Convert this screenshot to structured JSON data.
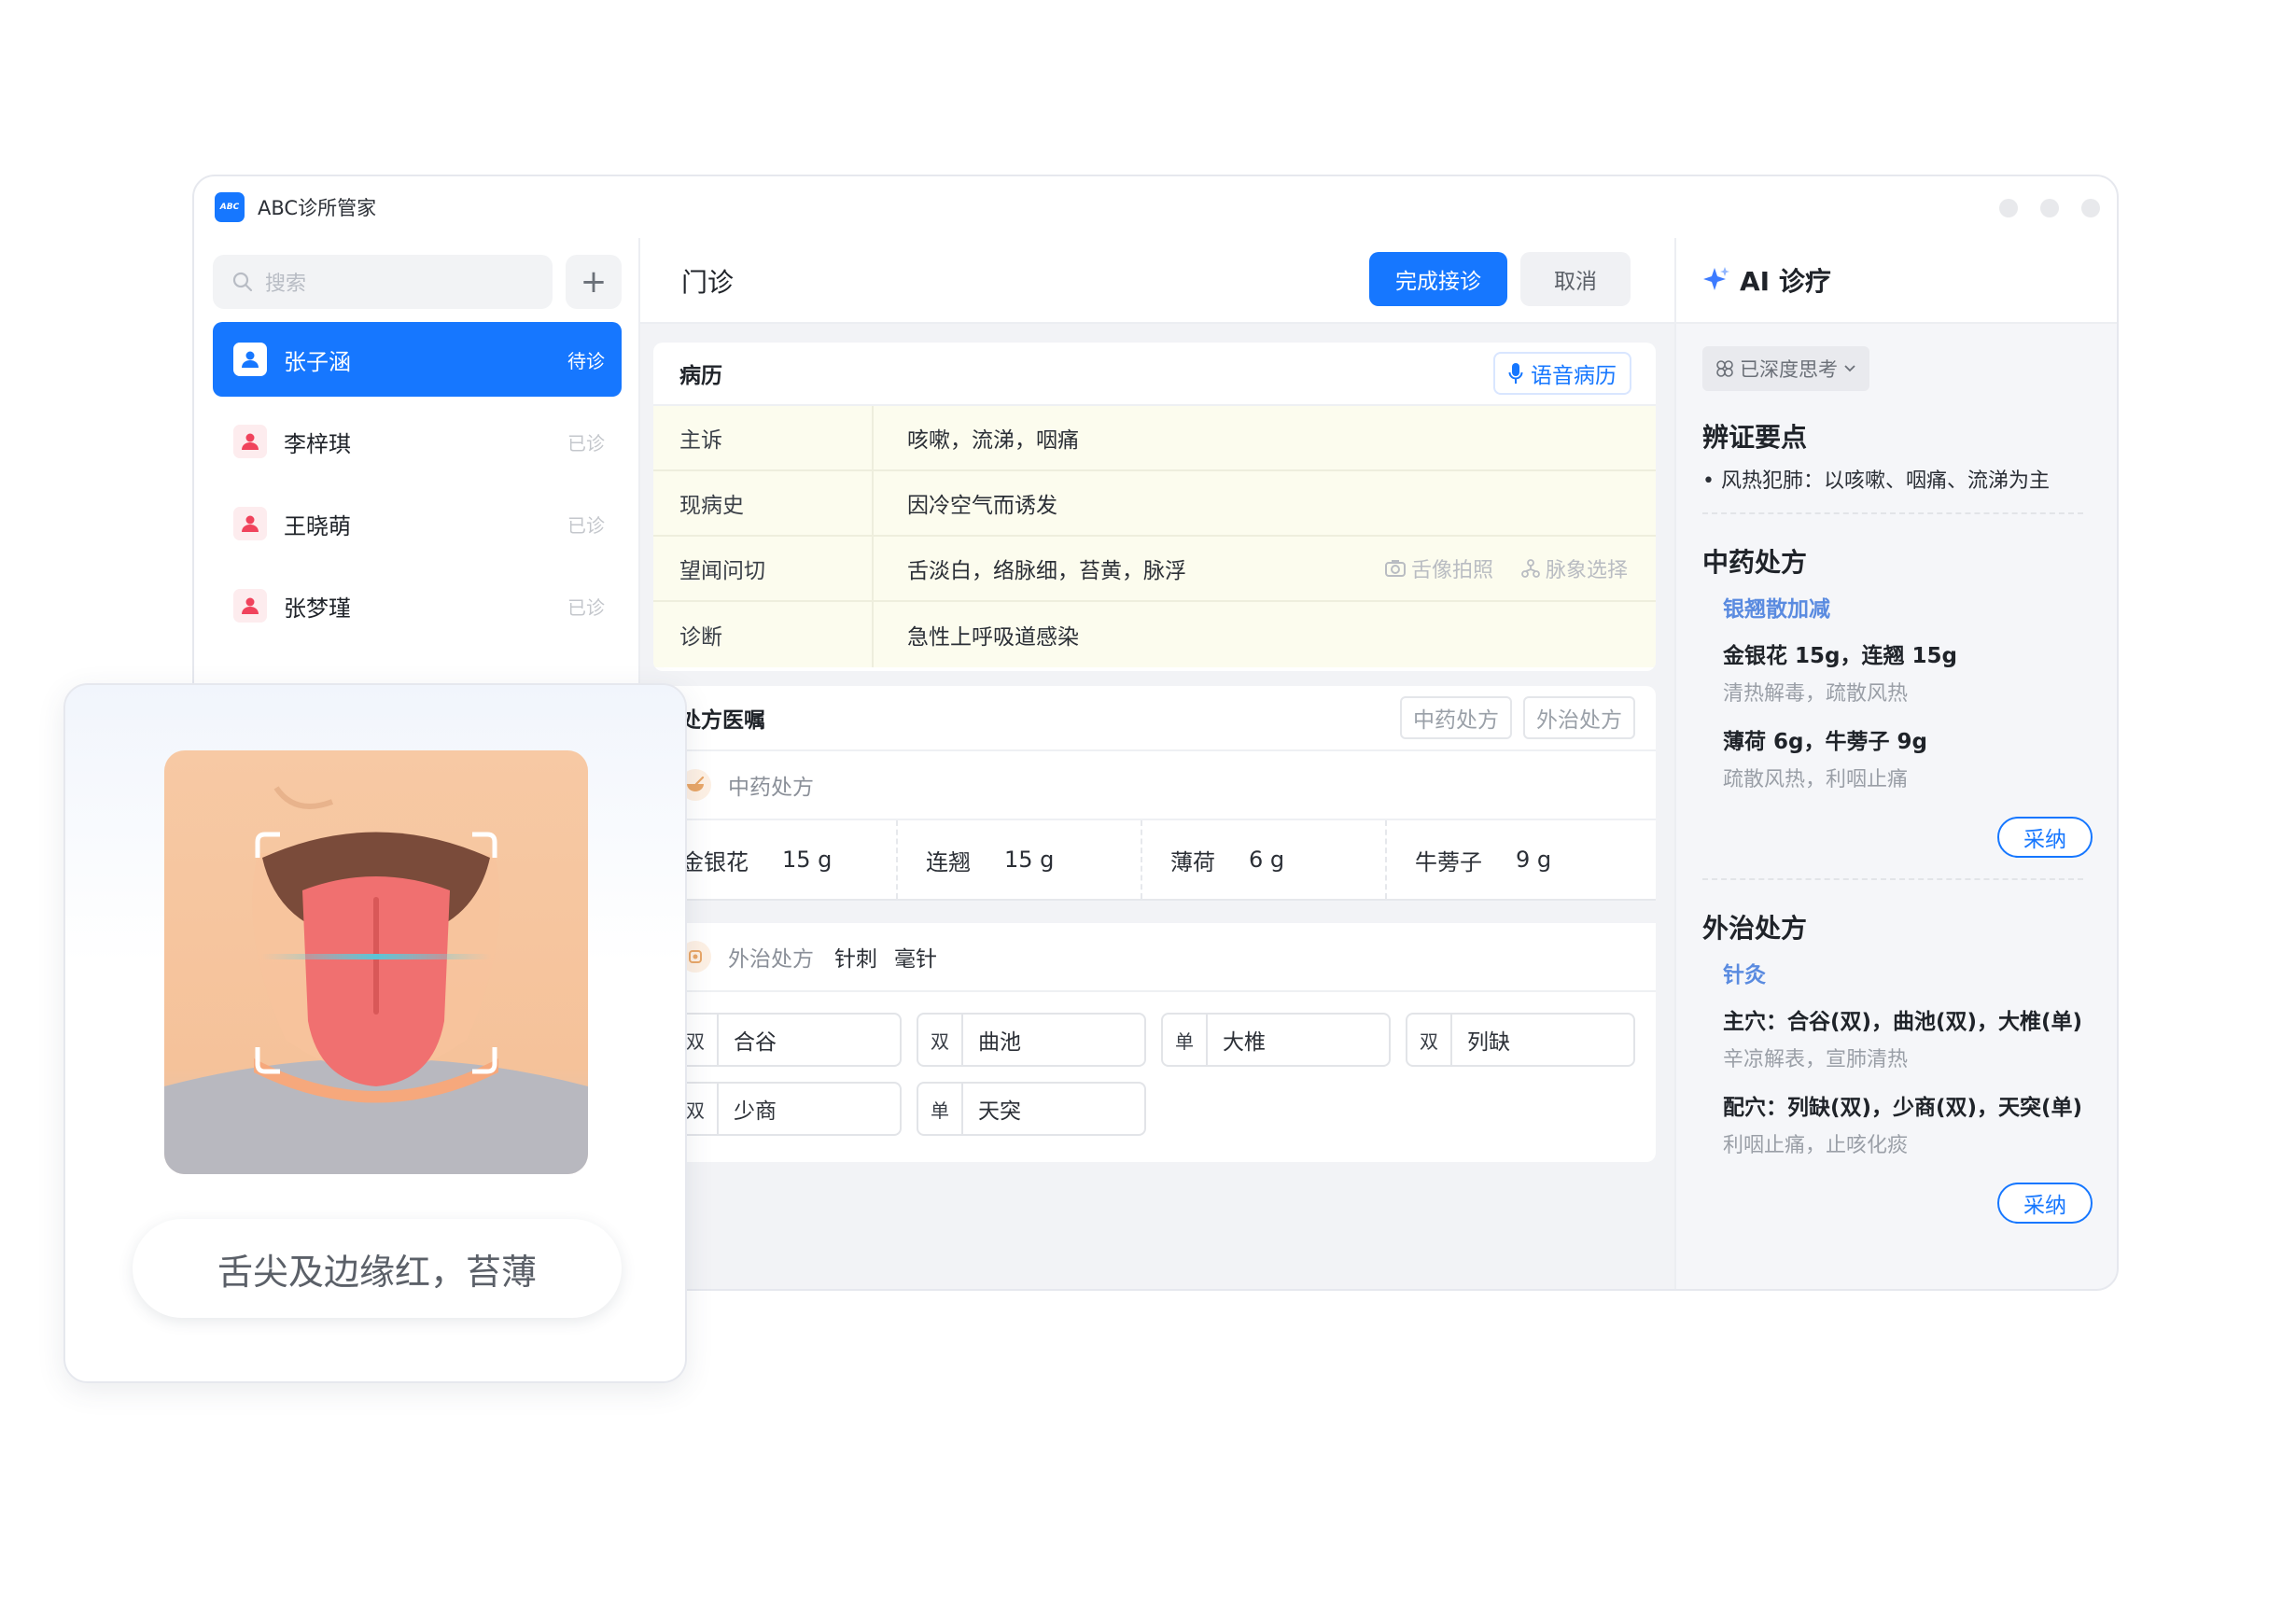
{
  "app": {
    "logo_text": "ABC",
    "title": "ABC诊所管家"
  },
  "sidebar": {
    "search_placeholder": "搜索",
    "add_label": "+",
    "patients": [
      {
        "name": "张子涵",
        "status": "待诊",
        "active": true
      },
      {
        "name": "李梓琪",
        "status": "已诊",
        "active": false
      },
      {
        "name": "王晓萌",
        "status": "已诊",
        "active": false
      },
      {
        "name": "张梦瑾",
        "status": "已诊",
        "active": false
      }
    ]
  },
  "main": {
    "title": "门诊",
    "complete_button": "完成接诊",
    "cancel_button": "取消",
    "record": {
      "title": "病历",
      "voice_button": "语音病历",
      "rows": [
        {
          "label": "主诉",
          "value": "咳嗽，流涕，咽痛"
        },
        {
          "label": "现病史",
          "value": "因冷空气而诱发"
        },
        {
          "label": "望闻问切",
          "value": "舌淡白，络脉细，苔黄，脉浮"
        },
        {
          "label": "诊断",
          "value": "急性上呼吸道感染"
        }
      ],
      "tongue_photo": "舌像拍照",
      "pulse_select": "脉象选择"
    },
    "prescription": {
      "title": "处方医嘱",
      "tab_tcm": "中药处方",
      "tab_external": "外治处方",
      "tcm_title": "中药处方",
      "herbs": [
        {
          "name": "金银花",
          "dose": "15 g"
        },
        {
          "name": "连翘",
          "dose": "15 g"
        },
        {
          "name": "薄荷",
          "dose": "6 g"
        },
        {
          "name": "牛蒡子",
          "dose": "9 g"
        }
      ],
      "external_title": "外治处方",
      "external_type": "针刺",
      "external_tool": "毫针",
      "points": [
        {
          "side": "双",
          "name": "合谷"
        },
        {
          "side": "双",
          "name": "曲池"
        },
        {
          "side": "单",
          "name": "大椎"
        },
        {
          "side": "双",
          "name": "列缺"
        },
        {
          "side": "双",
          "name": "少商"
        },
        {
          "side": "单",
          "name": "天突"
        }
      ]
    }
  },
  "ai": {
    "title": "AI 诊疗",
    "think_chip": "已深度思考",
    "diag_title": "辨证要点",
    "diag_point": "风热犯肺：以咳嗽、咽痛、流涕为主",
    "tcm_title": "中药处方",
    "tcm_formula": "银翘散加减",
    "tcm_line1": "金银花 15g，连翘 15g",
    "tcm_note1": "清热解毒，疏散风热",
    "tcm_line2": "薄荷 6g，牛蒡子 9g",
    "tcm_note2": "疏散风热，利咽止痛",
    "adopt": "采纳",
    "ext_title": "外治处方",
    "ext_method": "针灸",
    "ext_line1": "主穴：合谷(双)，曲池(双)，大椎(单)",
    "ext_note1": "辛凉解表，宣肺清热",
    "ext_line2": "配穴：列缺(双)，少商(双)，天突(单)",
    "ext_note2": "利咽止痛，止咳化痰"
  },
  "tongue_card": {
    "caption": "舌尖及边缘红，苔薄"
  },
  "colors": {
    "accent": "#1677ff",
    "record_bg": "#fcfcee",
    "ai_link": "#5a8be0"
  }
}
